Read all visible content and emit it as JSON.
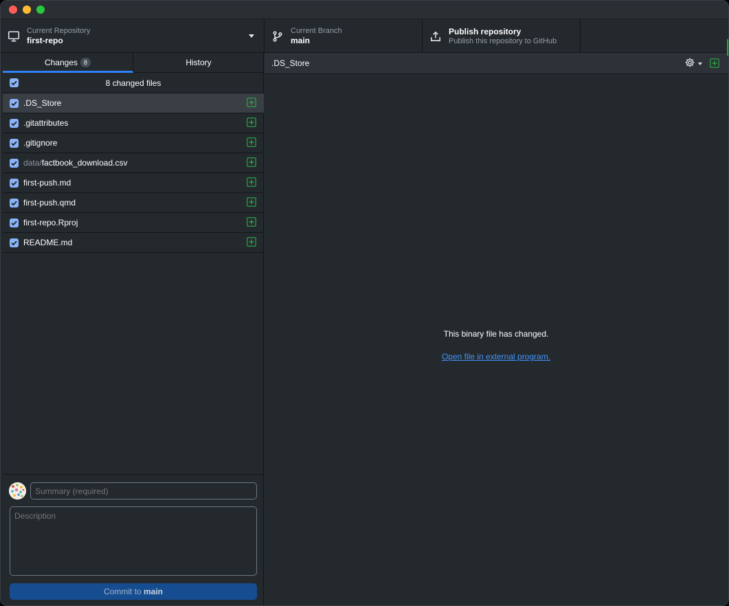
{
  "toolbar": {
    "repository": {
      "sub": "Current Repository",
      "main": "first-repo"
    },
    "branch": {
      "sub": "Current Branch",
      "main": "main"
    },
    "publish": {
      "main": "Publish repository",
      "sub": "Publish this repository to GitHub"
    }
  },
  "sidebar": {
    "tabs": [
      {
        "label": "Changes",
        "badge": "8"
      },
      {
        "label": "History"
      }
    ],
    "changed_files_label": "8 changed files",
    "files": [
      {
        "dir": "",
        "name": ".DS_Store",
        "selected": true
      },
      {
        "dir": "",
        "name": ".gitattributes"
      },
      {
        "dir": "",
        "name": ".gitignore"
      },
      {
        "dir": "data/",
        "name": "factbook_download.csv"
      },
      {
        "dir": "",
        "name": "first-push.md"
      },
      {
        "dir": "",
        "name": "first-push.qmd"
      },
      {
        "dir": "",
        "name": "first-repo.Rproj"
      },
      {
        "dir": "",
        "name": "README.md"
      }
    ],
    "commit": {
      "summary_placeholder": "Summary (required)",
      "description_placeholder": "Description",
      "button_prefix": "Commit to ",
      "button_branch": "main"
    }
  },
  "main": {
    "file_path": ".DS_Store",
    "binary_message": "This binary file has changed.",
    "open_link": "Open file in external program."
  },
  "colors": {
    "accent": "#2f81f7",
    "added": "#2ea043",
    "commit_button": "#164d91",
    "link": "#4493f8"
  },
  "icons": [
    "desktop-icon",
    "branch-icon",
    "upload-icon",
    "gear-icon",
    "file-added-icon",
    "checkbox-icon"
  ]
}
